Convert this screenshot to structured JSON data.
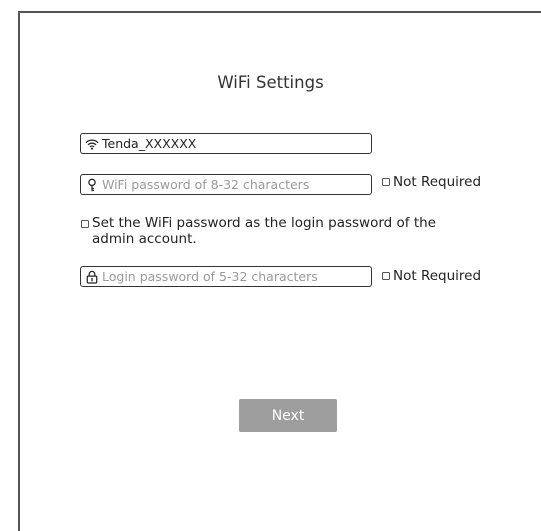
{
  "page": {
    "title": "WiFi Settings"
  },
  "ssid": {
    "value": "Tenda_XXXXXX",
    "icon": "wifi-icon"
  },
  "wifi_password": {
    "placeholder": "WiFi password of 8-32 characters",
    "icon": "key-icon",
    "not_required_label": "Not Required"
  },
  "sync_password": {
    "line1": "Set the WiFi password as the login password of the",
    "line2": "admin account."
  },
  "login_password": {
    "placeholder": "Login password of 5-32 characters",
    "icon": "lock-icon",
    "not_required_label": "Not Required"
  },
  "actions": {
    "next_label": "Next"
  },
  "colors": {
    "button_bg": "#9e9e9e",
    "border": "#333333",
    "placeholder": "#9a9a9a"
  }
}
